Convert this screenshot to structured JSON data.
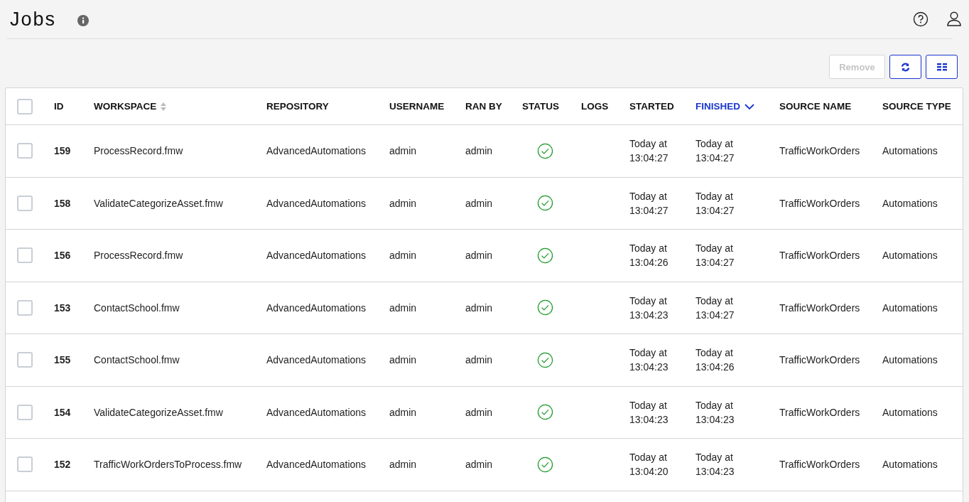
{
  "page": {
    "title": "Jobs"
  },
  "toolbar": {
    "remove": {
      "label": "Remove",
      "disabled": true
    }
  },
  "table": {
    "all_checked": false,
    "columns": [
      {
        "label": "ID",
        "sortable": false,
        "sorted": false
      },
      {
        "label": "WORKSPACE",
        "sortable": true,
        "sorted": false
      },
      {
        "label": "REPOSITORY",
        "sortable": false,
        "sorted": false
      },
      {
        "label": "USERNAME",
        "sortable": false,
        "sorted": false
      },
      {
        "label": "RAN BY",
        "sortable": false,
        "sorted": false
      },
      {
        "label": "STATUS",
        "sortable": false,
        "sorted": false
      },
      {
        "label": "LOGS",
        "sortable": false,
        "sorted": false
      },
      {
        "label": "STARTED",
        "sortable": false,
        "sorted": false
      },
      {
        "label": "FINISHED",
        "sortable": false,
        "sorted": true
      },
      {
        "label": "SOURCE NAME",
        "sortable": false,
        "sorted": false
      },
      {
        "label": "SOURCE TYPE",
        "sortable": false,
        "sorted": false
      }
    ],
    "rows": [
      {
        "checked": false,
        "id": "159",
        "workspace": "ProcessRecord.fmw",
        "repository": "AdvancedAutomations",
        "username": "admin",
        "ran_by": "admin",
        "succeeded": true,
        "started": "Today at 13:04:27",
        "finished": "Today at 13:04:27",
        "source_name": "TrafficWorkOrders",
        "source_type": "Automations"
      },
      {
        "checked": false,
        "id": "158",
        "workspace": "ValidateCategorizeAsset.fmw",
        "repository": "AdvancedAutomations",
        "username": "admin",
        "ran_by": "admin",
        "succeeded": true,
        "started": "Today at 13:04:27",
        "finished": "Today at 13:04:27",
        "source_name": "TrafficWorkOrders",
        "source_type": "Automations"
      },
      {
        "checked": false,
        "id": "156",
        "workspace": "ProcessRecord.fmw",
        "repository": "AdvancedAutomations",
        "username": "admin",
        "ran_by": "admin",
        "succeeded": true,
        "started": "Today at 13:04:26",
        "finished": "Today at 13:04:27",
        "source_name": "TrafficWorkOrders",
        "source_type": "Automations"
      },
      {
        "checked": false,
        "id": "153",
        "workspace": "ContactSchool.fmw",
        "repository": "AdvancedAutomations",
        "username": "admin",
        "ran_by": "admin",
        "succeeded": true,
        "started": "Today at 13:04:23",
        "finished": "Today at 13:04:27",
        "source_name": "TrafficWorkOrders",
        "source_type": "Automations"
      },
      {
        "checked": false,
        "id": "155",
        "workspace": "ContactSchool.fmw",
        "repository": "AdvancedAutomations",
        "username": "admin",
        "ran_by": "admin",
        "succeeded": true,
        "started": "Today at 13:04:23",
        "finished": "Today at 13:04:26",
        "source_name": "TrafficWorkOrders",
        "source_type": "Automations"
      },
      {
        "checked": false,
        "id": "154",
        "workspace": "ValidateCategorizeAsset.fmw",
        "repository": "AdvancedAutomations",
        "username": "admin",
        "ran_by": "admin",
        "succeeded": true,
        "started": "Today at 13:04:23",
        "finished": "Today at 13:04:23",
        "source_name": "TrafficWorkOrders",
        "source_type": "Automations"
      },
      {
        "checked": false,
        "id": "152",
        "workspace": "TrafficWorkOrdersToProcess.fmw",
        "repository": "AdvancedAutomations",
        "username": "admin",
        "ran_by": "admin",
        "succeeded": true,
        "started": "Today at 13:04:20",
        "finished": "Today at 13:04:23",
        "source_name": "TrafficWorkOrders",
        "source_type": "Automations"
      }
    ]
  }
}
